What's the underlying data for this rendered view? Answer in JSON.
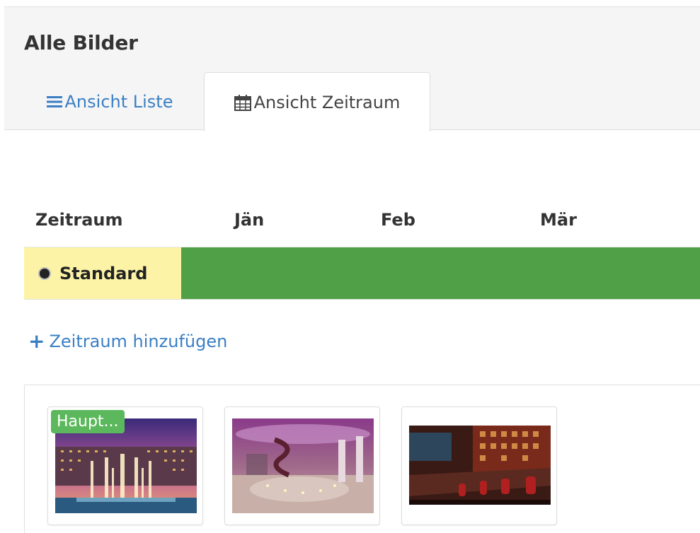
{
  "page": {
    "title": "Alle Bilder"
  },
  "tabs": [
    {
      "label": "Ansicht Liste",
      "icon": "list-icon",
      "active": false
    },
    {
      "label": "Ansicht Zeitraum",
      "icon": "calendar-icon",
      "active": true
    }
  ],
  "timeline": {
    "headers": [
      "Zeitraum",
      "Jän",
      "Feb",
      "Mär"
    ],
    "rows": [
      {
        "label": "Standard",
        "selected": true,
        "bar_color": "#50a048"
      }
    ],
    "add_label": "Zeitraum hinzufügen"
  },
  "gallery": {
    "items": [
      {
        "image": "fountain-hotel-photo",
        "badge": "Haupt..."
      },
      {
        "image": "lobby-spiral-staircase-photo",
        "badge": ""
      },
      {
        "image": "bar-interior-photo",
        "badge": ""
      }
    ]
  },
  "colors": {
    "link": "#3a7fc4",
    "bar": "#50a048",
    "row_highlight": "#fcf3a7",
    "badge": "#5cb85c"
  }
}
